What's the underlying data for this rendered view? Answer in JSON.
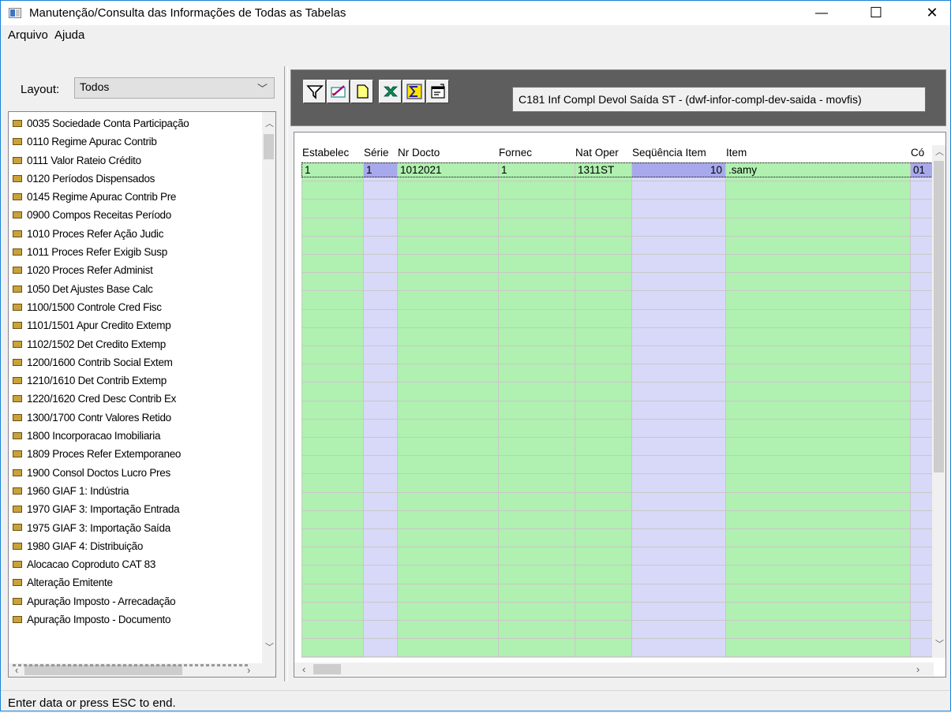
{
  "window": {
    "title": "Manutenção/Consulta das Informações de Todas as Tabelas",
    "minimize": "—",
    "maximize": "☐",
    "close": "✕"
  },
  "menu": {
    "file": "Arquivo",
    "help": "Ajuda"
  },
  "layout": {
    "label": "Layout:",
    "value": "Todos"
  },
  "tree": {
    "items": [
      "0035 Sociedade Conta Participação",
      "0110 Regime Apurac Contrib",
      "0111 Valor Rateio Crédito",
      "0120 Períodos Dispensados",
      "0145 Regime Apurac Contrib Pre",
      "0900 Compos Receitas Período",
      "1010 Proces Refer Ação Judic",
      "1011 Proces Refer Exigib Susp",
      "1020 Proces Refer Administ",
      "1050 Det Ajustes Base Calc",
      "1100/1500 Controle Cred Fisc",
      "1101/1501 Apur Credito Extemp",
      "1102/1502 Det Credito Extemp",
      "1200/1600 Contrib Social Extem",
      "1210/1610 Det Contrib Extemp",
      "1220/1620 Cred Desc Contrib Ex",
      "1300/1700 Contr Valores Retido",
      "1800 Incorporacao Imobiliaria",
      "1809 Proces Refer Extemporaneo",
      "1900 Consol Doctos Lucro Pres",
      "1960 GIAF 1: Indústria",
      "1970 GIAF 3: Importação Entrada",
      "1975 GIAF 3: Importação Saída",
      "1980 GIAF 4: Distribuição",
      "Alocacao Coproduto CAT 83",
      "Alteração Emitente",
      "Apuração Imposto - Arrecadação",
      "Apuração Imposto - Documento"
    ]
  },
  "toolbar": {
    "icons": [
      "filter-icon",
      "edit-icon",
      "new-icon",
      "excel-icon",
      "sum-icon",
      "properties-icon"
    ]
  },
  "table_info": "C181 Inf Compl Devol Saída ST - (dwf-infor-compl-dev-saida - movfis)",
  "grid": {
    "columns": [
      "Estabelec",
      "Série",
      "Nr Docto",
      "Fornec",
      "Nat Oper",
      "Seqüência Item",
      "Item",
      "Có"
    ],
    "row": [
      "1",
      "1",
      "1012021",
      "1",
      "1311ST",
      "10",
      ".samy",
      "01"
    ]
  },
  "colors": {
    "green": "#b0f0b0",
    "lavender": "#d8d8f8",
    "lavender_sel": "#a8a8ec"
  },
  "status": "Enter data or press ESC to end."
}
